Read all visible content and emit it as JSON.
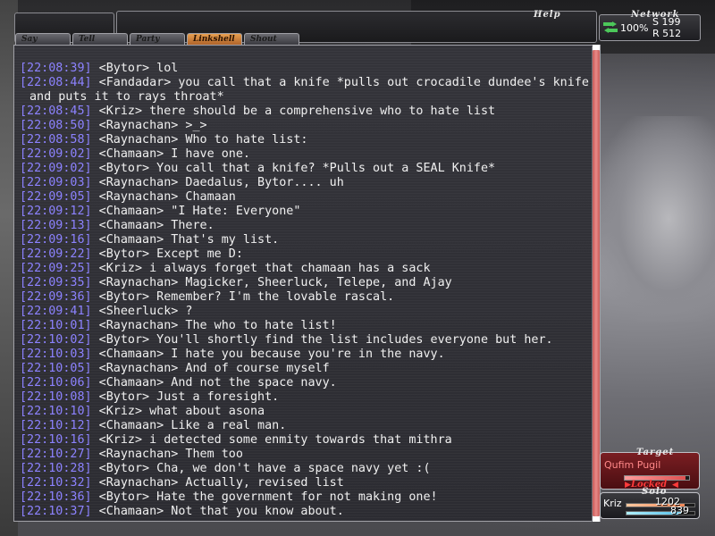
{
  "header": {
    "help_label": "Help",
    "network_label": "Network",
    "network_percent": "100%",
    "network_s": "S 199",
    "network_r": "R 512"
  },
  "tabs": [
    {
      "label": "Say",
      "active": false
    },
    {
      "label": "Tell",
      "active": false
    },
    {
      "label": "Party",
      "active": false
    },
    {
      "label": "Linkshell",
      "active": true
    },
    {
      "label": "Shout",
      "active": false
    }
  ],
  "chat": {
    "lines": [
      {
        "time": "[22:08:39]",
        "text": " <Bytor> lol"
      },
      {
        "time": "[22:08:44]",
        "text": " <Fandadar> you call that a knife *pulls out crocadile dundee's knife"
      },
      {
        "time": "",
        "text": "and puts it to rays throat*"
      },
      {
        "time": "[22:08:45]",
        "text": " <Kriz> there should be a comprehensive who to hate list"
      },
      {
        "time": "[22:08:50]",
        "text": " <Raynachan> >_>"
      },
      {
        "time": "[22:08:58]",
        "text": " <Raynachan> Who to hate list:"
      },
      {
        "time": "[22:09:02]",
        "text": " <Chamaan> I have one."
      },
      {
        "time": "[22:09:02]",
        "text": " <Bytor> You call that a knife? *Pulls out a SEAL Knife*"
      },
      {
        "time": "[22:09:03]",
        "text": " <Raynachan> Daedalus, Bytor.... uh"
      },
      {
        "time": "[22:09:05]",
        "text": " <Raynachan> Chamaan"
      },
      {
        "time": "[22:09:12]",
        "text": " <Chamaan> \"I Hate: Everyone\""
      },
      {
        "time": "[22:09:13]",
        "text": " <Chamaan> There."
      },
      {
        "time": "[22:09:16]",
        "text": " <Chamaan> That's my list."
      },
      {
        "time": "[22:09:22]",
        "text": " <Bytor> Except me D:"
      },
      {
        "time": "[22:09:25]",
        "text": " <Kriz> i always forget that chamaan has a sack"
      },
      {
        "time": "[22:09:35]",
        "text": " <Raynachan> Magicker, Sheerluck, Telepe, and Ajay"
      },
      {
        "time": "[22:09:36]",
        "text": " <Bytor> Remember? I'm the lovable rascal."
      },
      {
        "time": "[22:09:41]",
        "text": " <Sheerluck> ?"
      },
      {
        "time": "[22:10:01]",
        "text": " <Raynachan> The who to hate list!"
      },
      {
        "time": "[22:10:02]",
        "text": " <Bytor> You'll shortly find the list includes everyone but her."
      },
      {
        "time": "[22:10:03]",
        "text": " <Chamaan> I hate you because you're in the navy."
      },
      {
        "time": "[22:10:05]",
        "text": " <Raynachan> And of course myself"
      },
      {
        "time": "[22:10:06]",
        "text": " <Chamaan> And not the space navy."
      },
      {
        "time": "[22:10:08]",
        "text": " <Bytor> Just a foresight."
      },
      {
        "time": "[22:10:10]",
        "text": " <Kriz> what about asona"
      },
      {
        "time": "[22:10:12]",
        "text": " <Chamaan> Like a real man."
      },
      {
        "time": "[22:10:16]",
        "text": " <Kriz> i detected some enmity towards that mithra"
      },
      {
        "time": "[22:10:27]",
        "text": " <Raynachan> Them too"
      },
      {
        "time": "[22:10:28]",
        "text": " <Bytor> Cha, we don't have a space navy yet :("
      },
      {
        "time": "[22:10:32]",
        "text": " <Raynachan> Actually, revised list"
      },
      {
        "time": "[22:10:36]",
        "text": " <Bytor> Hate the government for not making one!"
      },
      {
        "time": "[22:10:37]",
        "text": " <Chamaan> Not that you know about."
      }
    ]
  },
  "target": {
    "label": "Target",
    "name": "Qufim Pugil",
    "hp_fraction": 0.95,
    "locked_label": "Locked"
  },
  "party": {
    "label": "Solo",
    "member_name": "Kriz",
    "hp": "1202",
    "mp": "839",
    "hp_fraction": 0.85,
    "mp_fraction": 0.8
  },
  "colors": {
    "timestamp": "#8c82ff",
    "chat_text": "#f0f0f0",
    "active_tab": "#e8a050",
    "target_bg": "#7a1e22"
  }
}
